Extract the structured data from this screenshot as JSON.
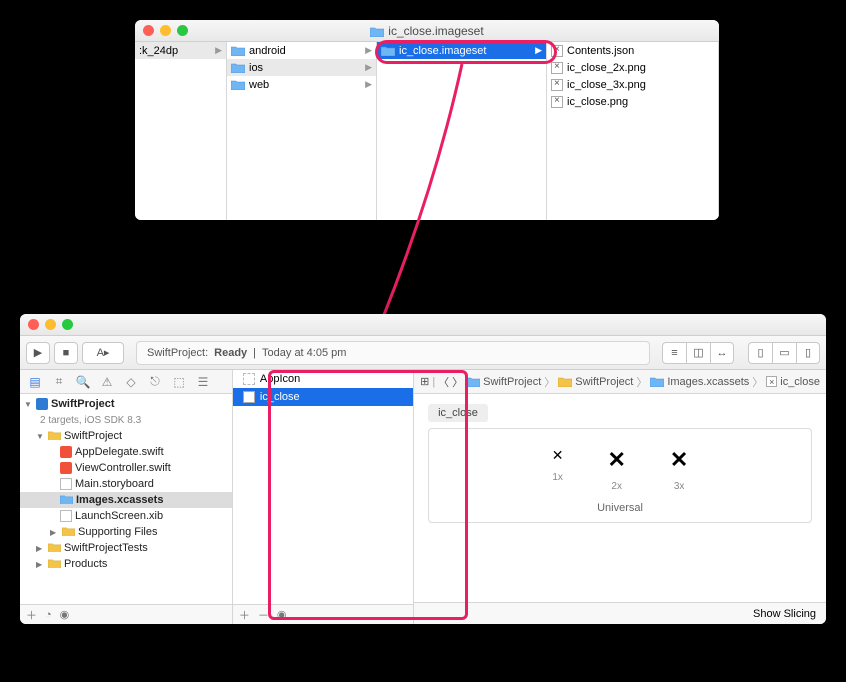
{
  "finder": {
    "title": "ic_close.imageset",
    "col0": {
      "item": ":k_24dp"
    },
    "col1": {
      "items": [
        "android",
        "ios",
        "web"
      ]
    },
    "col2": {
      "item": "ic_close.imageset"
    },
    "col3": {
      "items": [
        "Contents.json",
        "ic_close_2x.png",
        "ic_close_3x.png",
        "ic_close.png"
      ]
    }
  },
  "xcode": {
    "run": "▶",
    "stop": "■",
    "status_project": "SwiftProject:",
    "status_state": "Ready",
    "status_time": "Today at 4:05 pm",
    "navigator": {
      "project": "SwiftProject",
      "subtitle": "2 targets, iOS SDK 8.3",
      "group": "SwiftProject",
      "files": [
        "AppDelegate.swift",
        "ViewController.swift",
        "Main.storyboard",
        "Images.xcassets",
        "LaunchScreen.xib",
        "Supporting Files"
      ],
      "tests": "SwiftProjectTests",
      "products": "Products"
    },
    "assets": {
      "appicon": "AppIcon",
      "icclose": "ic_close"
    },
    "jumpbar": [
      "SwiftProject",
      "SwiftProject",
      "Images.xcassets",
      "ic_close"
    ],
    "preview": {
      "name": "ic_close",
      "labels": [
        "1x",
        "2x",
        "3x"
      ],
      "universal": "Universal"
    },
    "show_slicing": "Show Slicing"
  }
}
